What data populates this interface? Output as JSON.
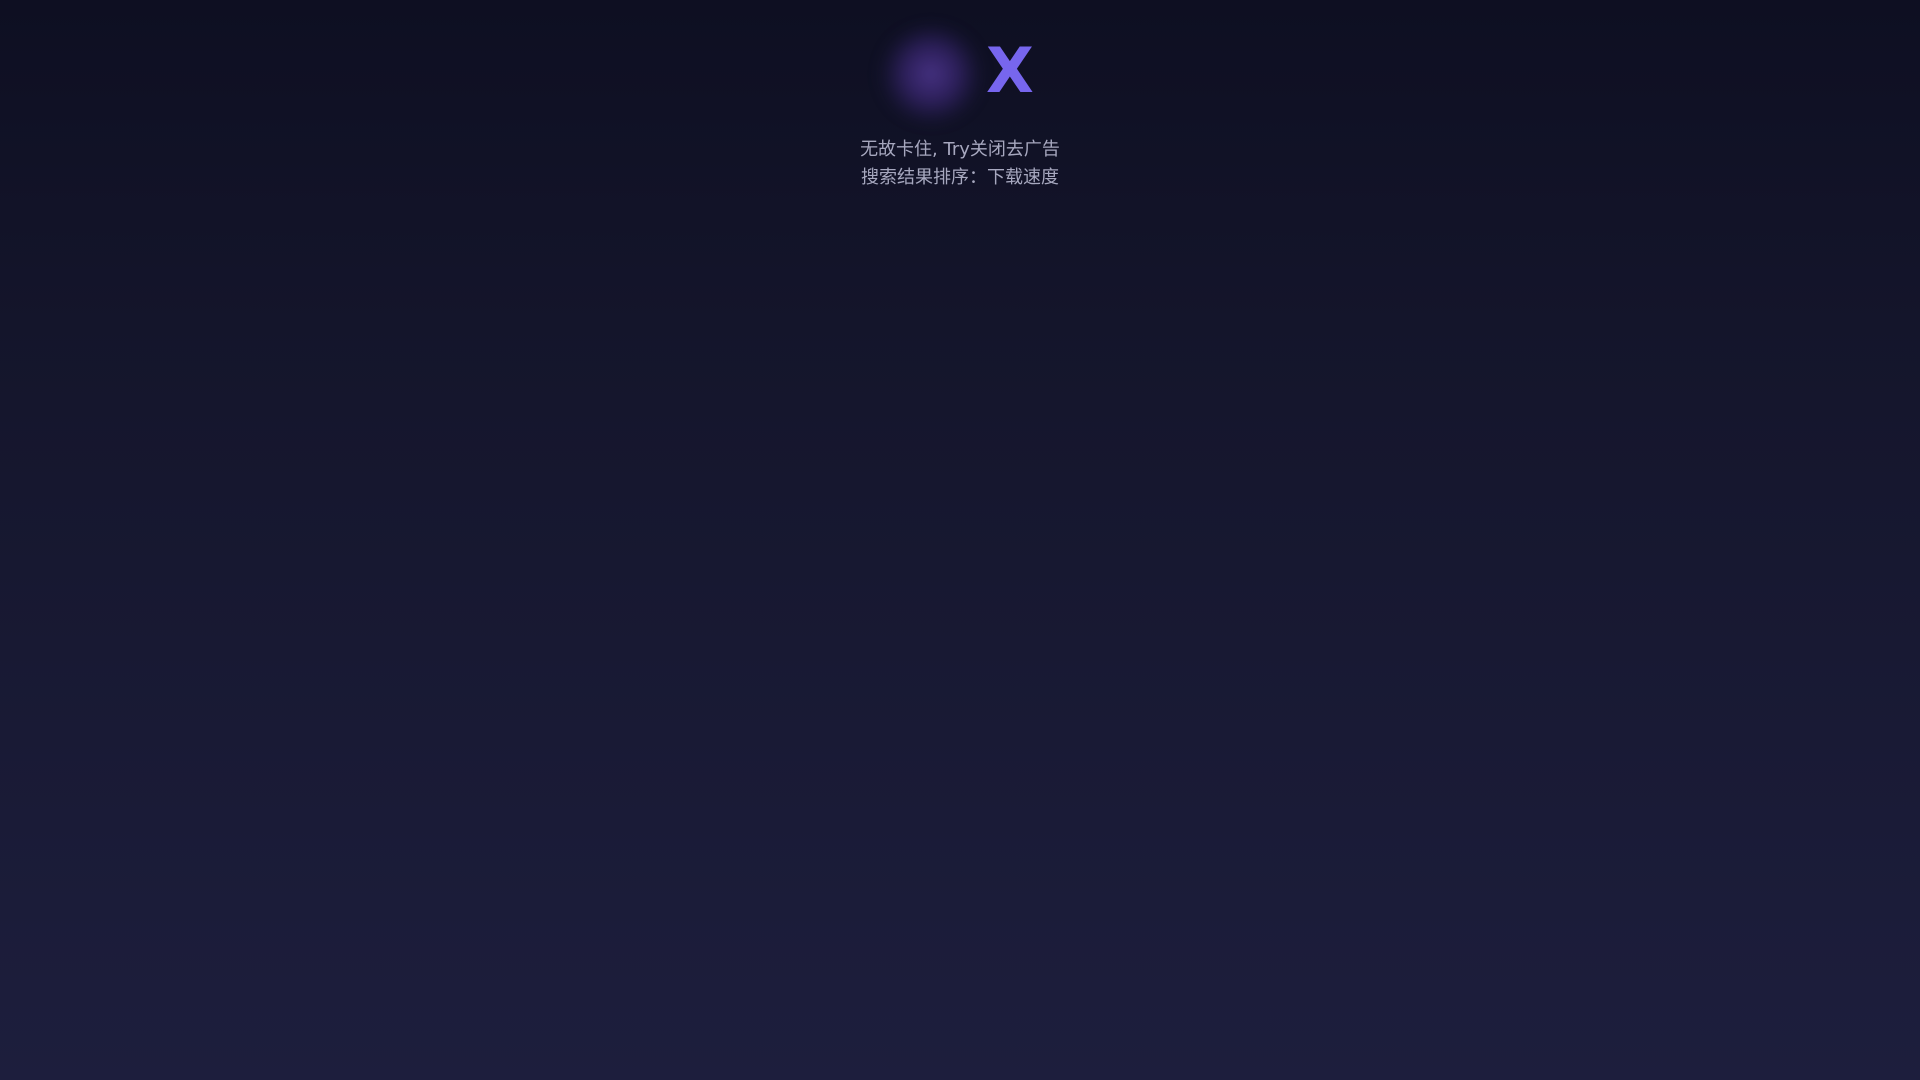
{
  "logo": {
    "mark_icon": "blurred-orb-icon",
    "letter": "X",
    "accent_color": "#7766ee"
  },
  "tips": {
    "line1": "无故卡住, Try关闭去广告",
    "line2": "搜索结果排序：下载速度"
  }
}
